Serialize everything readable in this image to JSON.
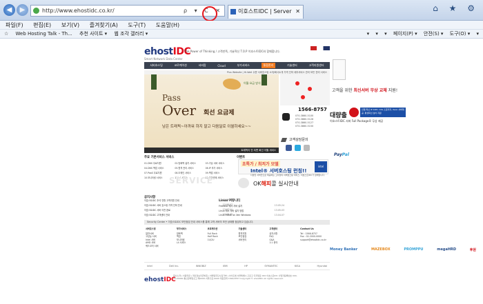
{
  "browser": {
    "url": "http://www.ehostidc.co.kr/",
    "addr_buttons": "ρ ▾ C ✕",
    "tab_title": "이호스트IDC | Server Hosti...",
    "tab_close": "✕",
    "window_controls": "⌂ ★ ⚙",
    "back": "◀",
    "forward": "▶"
  },
  "menu": [
    "파일(F)",
    "편집(E)",
    "보기(V)",
    "즐겨찾기(A)",
    "도구(T)",
    "도움말(H)"
  ],
  "favorites": {
    "items": [
      "☆",
      "Web Hosting Talk - Th...",
      "추천 사이트 ▾",
      "웹 조각 갤러리 ▾"
    ],
    "right": [
      "▾",
      "▾",
      "▾",
      "페이지(P) ▾",
      "안전(S) ▾",
      "도구(O) ▾",
      "▾"
    ]
  },
  "site": {
    "logo": "ehost",
    "logo_accent": "IDC",
    "logo_sub": "Smart Network Data Center",
    "tagline": "The Power of Thinking / 고객만족, 기술혁신 T.O.P 이호스트IDC와 함께합니다.",
    "gnb": [
      "서버호스팅",
      "코로케이션",
      "서버팜",
      "Cloud",
      "부가서비스",
      "통합관리",
      "기술센터",
      "고객지원센터"
    ],
    "snb": "Plus Website | Hi-Wall  쉬운 서버호스팅  소개/회사소개  가격 인하  세부서비스 관리  모든 관리 서비스",
    "banner": {
      "pass": "Pass",
      "over": "Over",
      "subtitle": "회선 요금제",
      "desc": "남은 트래픽~아까워 하지 말고 다음달로 이월하세요~~",
      "hint": "이월 요금 방식",
      "bar": "트래픽이 안 되면 회선 이월 서비스"
    },
    "call": {
      "number": "1566-8757",
      "lines": [
        "070-3860-5100",
        "070-3860-5126",
        "070-3860-5127",
        "070-3860-5150"
      ]
    },
    "qa": "고객상담문의",
    "services": {
      "title": "주요 기본서비스 서비스",
      "items": [
        "01.DNS 무료지원",
        "02.방화벽 설치 서비스",
        "03.가상 서버 서비스",
        "04.DNS 백업 서비스",
        "05.원격 관리 서비스",
        "06.IP 추가 서비스",
        "07.PaaS 무료지원",
        "08.도메인 서비스",
        "09.백업 서비스",
        "10.모니터링 서비스",
        "11.L4 서비스",
        "12.보안관제 서비스"
      ],
      "watermark": "SERVICE"
    },
    "event": {
      "title": "이벤트",
      "tag": "초특가 / 최저가 모델",
      "intel": "Intel® 서버호스팅 런칭!!",
      "sm": "다양한 서버군으로 제공하는 고사양의 서버호스팅 서비스, 이호스트IDC가 함께합니다.",
      "chip": "intel",
      "ok_prefix": "OK",
      "ok_mid": "해피",
      "ok_suffix": "콜 실시안내"
    },
    "notices": {
      "title": "공지사항",
      "items": [
        {
          "t": "이호스트IDC 추석 연휴 고객지원 안내",
          "d": "13.09.01"
        },
        {
          "t": "이호스트IDC 서버 호스팅 가격 인하 안내",
          "d": "13.08.07"
        },
        {
          "t": "이호스트IDC 서버 이전 완료",
          "d": "13.07.11"
        },
        {
          "t": "이호스트IDC 고객센터 안내",
          "d": "13.06.22"
        }
      ]
    },
    "linux": {
      "title": "Linux 커뮤니티",
      "items": [
        {
          "t": "FreeBSD 에서 자바 설치",
          "d": "13.05.24"
        },
        {
          "t": "Linux 에서 자바 설치 방법",
          "d": "13.05.03"
        },
        {
          "t": "Linux Install on Xen Windows",
          "d": "13.04.07"
        }
      ]
    },
    "security": "Security Center  •  이호스트IDC 보안점검 안내 서비스를 통해 고객 서버의 보안 상태를 점검하고 있습니다.",
    "bottom_cols": [
      {
        "h": "서버호스팅",
        "items": [
          "일반서버",
          "고성능 서버",
          "Intel 서버",
          "AMD 서버",
          "쿼드코어 서버"
        ]
      },
      {
        "h": "부가서비스",
        "items": [
          "방화벽",
          "백업",
          "모니터링",
          "L4 서비스"
        ]
      },
      {
        "h": "코로케이션",
        "items": [
          "Full Rack",
          "Half Rack",
          "1U/2U"
        ]
      },
      {
        "h": "기술센터",
        "items": [
          "원격지원",
          "보안점검",
          "서버관리"
        ]
      },
      {
        "h": "고객센터",
        "items": [
          "공지사항",
          "FAQ",
          "Q&A",
          "1:1 문의"
        ]
      },
      {
        "h": "Contact Us",
        "items": [
          "Tel : 1566-8757",
          "Fax : 02-2000-0000",
          "support@ehostidc.co.kr"
        ]
      }
    ],
    "partners": [
      "intel",
      "Dell Inc.",
      "INNOBIZ",
      "IBM",
      "HP",
      "SYMANTEC",
      "KISA",
      "Hyundai"
    ],
    "footer": {
      "logo": "ehost",
      "logo_accent": "IDC",
      "text": "회사소개 | 이용약관 | 개인정보취급방침 | 이메일무단수집거부 | 사이트맵   서울특별시 구로구 디지털로 000 이호스트IDC   사업자등록번호 000-00-00000   통신판매업신고 제0000-서울구로-0000   대표전화 1566-8757   Copyright © ehostIDC All rights reserved."
    }
  },
  "right_ad": {
    "text_prefix": "고객을 위한",
    "text_bold": "최신서버 무상 교체",
    "text_suffix": "지원!"
  },
  "daehak_ad": {
    "title": "대량출",
    "box": "인텔 최신 IP 10M, 10G 스토리지, Xeon 서버제공, 평생회선 설치 지원",
    "sub": "이호스트IDC 서버 Full Package로 무상 제공"
  },
  "paypal_a": "Pay",
  "paypal_b": "Pal",
  "brands": [
    "Money Banker",
    "MAZEBOX",
    "PROMPPU",
    "megaHRD",
    "후원"
  ]
}
